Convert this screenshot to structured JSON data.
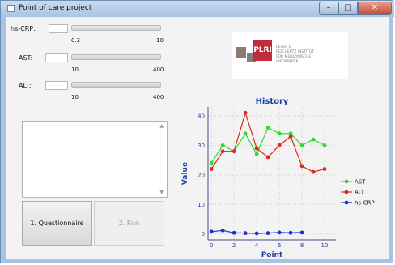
{
  "window": {
    "title": "Point of care project",
    "minimize_icon": "minimize-icon",
    "maximize_icon": "maximize-icon",
    "close_icon": "close-icon"
  },
  "controls": [
    {
      "label": "hs-CRP:",
      "value": "",
      "min": "0.3",
      "max": "10"
    },
    {
      "label": "AST:",
      "value": "",
      "min": "10",
      "max": "400"
    },
    {
      "label": "ALT:",
      "value": "",
      "min": "10",
      "max": "400"
    }
  ],
  "buttons": {
    "questionnaire": "1. Questionnaire",
    "run": "2. Run"
  },
  "logo": {
    "mark": "PLRI",
    "lines": [
      "PETER L.",
      "REICHERTZ INSTITUT",
      "FÜR MEDIZINISCHE",
      "INFORMATIK"
    ]
  },
  "chart_data": {
    "type": "line",
    "title": "History",
    "xlabel": "Point",
    "ylabel": "Value",
    "xlim": [
      -0.3,
      11
    ],
    "ylim": [
      -2,
      43
    ],
    "xticks": [
      0,
      2,
      4,
      6,
      8,
      10
    ],
    "yticks": [
      0,
      10,
      20,
      30,
      40
    ],
    "grid": true,
    "legend": "right",
    "series": [
      {
        "name": "AST",
        "color": "#33d933",
        "x": [
          0,
          1,
          2,
          3,
          4,
          5,
          6,
          7,
          8,
          9,
          10
        ],
        "values": [
          24,
          30,
          28,
          34,
          27,
          36,
          34,
          34,
          30,
          32,
          30
        ]
      },
      {
        "name": "ALT",
        "color": "#d82a20",
        "x": [
          0,
          1,
          2,
          3,
          4,
          5,
          6,
          7,
          8,
          9,
          10
        ],
        "values": [
          22,
          28,
          28,
          41,
          29,
          26,
          30,
          33,
          23,
          21,
          22
        ]
      },
      {
        "name": "hs-CRP",
        "color": "#1e2ed0",
        "x": [
          0,
          1,
          2,
          3,
          4,
          5,
          6,
          7,
          8
        ],
        "values": [
          0.8,
          1.2,
          0.4,
          0.3,
          0.2,
          0.3,
          0.5,
          0.4,
          0.5
        ]
      }
    ]
  }
}
